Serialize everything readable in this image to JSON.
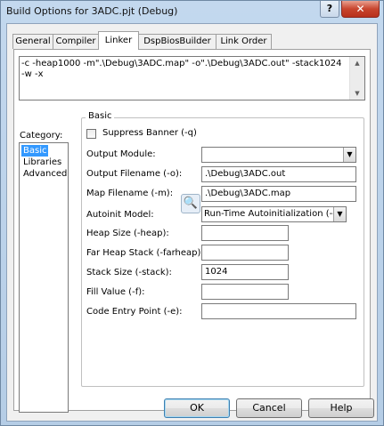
{
  "window": {
    "title": "Build Options for 3ADC.pjt (Debug)",
    "help_label": "?",
    "close_label": "✕"
  },
  "tabs": [
    {
      "label": "General"
    },
    {
      "label": "Compiler"
    },
    {
      "label": "Linker"
    },
    {
      "label": "DspBiosBuilder"
    },
    {
      "label": "Link Order"
    }
  ],
  "active_tab": "Linker",
  "command_line": "-c -heap1000 -m\".\\Debug\\3ADC.map\" -o\".\\Debug\\3ADC.out\" -stack1024 -w -x",
  "category": {
    "label": "Category:",
    "items": [
      {
        "label": "Basic"
      },
      {
        "label": "Libraries"
      },
      {
        "label": "Advanced"
      }
    ],
    "selected": "Basic"
  },
  "basic": {
    "group_label": "Basic",
    "suppress_banner": {
      "label": "Suppress Banner (-q)",
      "checked": false
    },
    "output_module": {
      "label": "Output Module:",
      "value": ""
    },
    "output_filename": {
      "label": "Output Filename (-o):",
      "value": ".\\Debug\\3ADC.out"
    },
    "map_filename": {
      "label": "Map Filename (-m):",
      "value": ".\\Debug\\3ADC.map"
    },
    "autoinit_model": {
      "label": "Autoinit Model:",
      "value": "Run-Time Autoinitialization (-c)"
    },
    "heap_size": {
      "label": "Heap Size (-heap):",
      "value": ""
    },
    "far_heap_stack": {
      "label": "Far Heap Stack (-farheap):",
      "value": ""
    },
    "stack_size": {
      "label": "Stack Size (-stack):",
      "value": "1024"
    },
    "fill_value": {
      "label": "Fill Value (-f):",
      "value": ""
    },
    "code_entry_point": {
      "label": "Code Entry Point (-e):",
      "value": ""
    }
  },
  "buttons": {
    "ok": "OK",
    "cancel": "Cancel",
    "help": "Help"
  },
  "icons": {
    "combo_arrow": "chevron-down-icon",
    "popup": "magnifier-icon"
  }
}
